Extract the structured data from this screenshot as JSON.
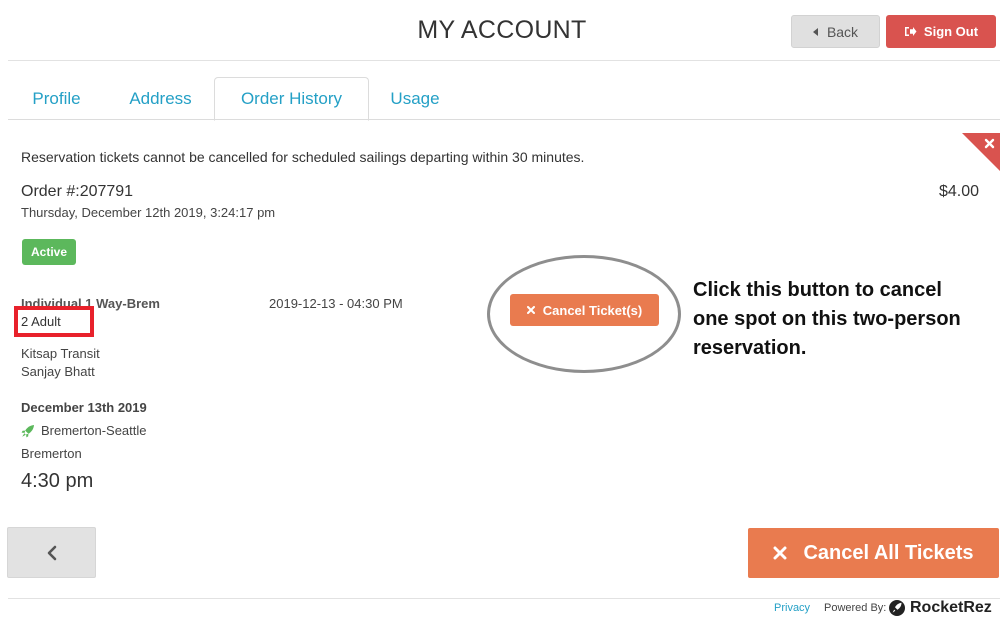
{
  "header": {
    "title": "MY ACCOUNT",
    "back_label": "Back",
    "signout_label": "Sign Out"
  },
  "tabs": [
    {
      "label": "Profile",
      "active": false
    },
    {
      "label": "Address",
      "active": false
    },
    {
      "label": "Order History",
      "active": true
    },
    {
      "label": "Usage",
      "active": false
    }
  ],
  "order": {
    "notice": "Reservation tickets cannot be cancelled for scheduled sailings departing within 30 minutes.",
    "number": "Order #:207791",
    "price": "$4.00",
    "date": "Thursday, December 12th 2019, 3:24:17 pm",
    "status": "Active",
    "ticket": {
      "type": "Individual 1 Way-Brem",
      "quantity": "2 Adult",
      "datetime": "2019-12-13 - 04:30 PM",
      "agency": "Kitsap Transit",
      "passenger": "Sanjay Bhatt",
      "cancel_label": "Cancel Ticket(s)"
    },
    "trip": {
      "date": "December 13th 2019",
      "route": "Bremerton-Seattle",
      "terminal": "Bremerton",
      "time": "4:30 pm"
    }
  },
  "annotation": {
    "text": "Click this button to cancel one spot on this two-person reservation."
  },
  "actions": {
    "cancel_all_label": "Cancel All Tickets"
  },
  "footer": {
    "privacy": "Privacy",
    "powered_by": "Powered By:",
    "brand": "RocketRez"
  },
  "colors": {
    "accent": "#24a0c6",
    "danger": "#d9534f",
    "warning": "#e97b4f",
    "success": "#5cb85c",
    "highlight": "#e8212b"
  }
}
